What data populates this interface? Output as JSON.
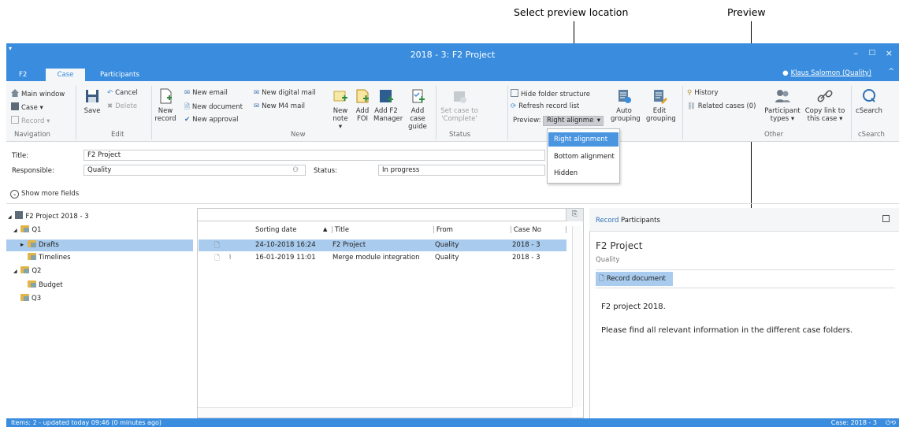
{
  "annotations": {
    "select_preview_location": "Select preview location",
    "preview": "Preview"
  },
  "window": {
    "title": "2018 - 3: F2 Project",
    "qat_icon": "chevron-down-icon",
    "user": "Klaus Salomon (Quality)",
    "controls": {
      "minimize": "–",
      "maximize": "□",
      "close": "×",
      "collapse": "^"
    }
  },
  "tabs": [
    {
      "label": "F2"
    },
    {
      "label": "Case"
    },
    {
      "label": "Participants"
    }
  ],
  "ribbon": {
    "navigation": {
      "label": "Navigation",
      "main_window": "Main window",
      "case": "Case ▾",
      "record": "Record ▾"
    },
    "edit": {
      "label": "Edit",
      "save": "Save",
      "cancel": "Cancel",
      "delete": "Delete"
    },
    "new": {
      "label": "New",
      "new_record": [
        "New",
        "record"
      ],
      "new_email": "New email",
      "new_document": "New document",
      "new_approval": "New approval",
      "new_digital_mail": "New digital mail",
      "new_m4_mail": "New M4 mail",
      "new_note": [
        "New",
        "note ▾"
      ],
      "add_foi": [
        "Add",
        "FOI"
      ],
      "add_f2_manager": [
        "Add F2",
        "Manager"
      ],
      "add_case_guide": [
        "Add case",
        "guide"
      ]
    },
    "status": {
      "label": "Status",
      "set_case": [
        "Set case to",
        "'Complete'"
      ]
    },
    "preview": {
      "hide_folder_structure": "Hide folder structure",
      "refresh_record_list": "Refresh record list",
      "preview_label": "Preview:",
      "selected": "Right alignme",
      "options": [
        "Right alignment",
        "Bottom alignment",
        "Hidden"
      ],
      "auto_grouping": [
        "Auto",
        "grouping"
      ],
      "edit_grouping": [
        "Edit",
        "grouping"
      ]
    },
    "other": {
      "label": "Other",
      "history": "History",
      "related_cases": "Related cases (0)",
      "participant_types": [
        "Participant",
        "types ▾"
      ],
      "copy_link": [
        "Copy link to",
        "this case ▾"
      ]
    },
    "csearch": {
      "label": "cSearch",
      "button": "cSearch"
    }
  },
  "fields": {
    "title_label": "Title:",
    "title_value": "F2 Project",
    "responsible_label": "Responsible:",
    "responsible_value": "Quality",
    "status_label": "Status:",
    "status_value": "In progress",
    "show_more": "Show more fields"
  },
  "tree": [
    {
      "label": "F2 Project 2018 - 3",
      "expander": "◢"
    },
    {
      "label": "Q1",
      "expander": "◢"
    },
    {
      "label": "Drafts",
      "expander": "▸"
    },
    {
      "label": "Timelines",
      "expander": ""
    },
    {
      "label": "Q2",
      "expander": "◢"
    },
    {
      "label": "Budget",
      "expander": ""
    },
    {
      "label": "Q3",
      "expander": ""
    }
  ],
  "list": {
    "columns": [
      "Sorting date",
      "Title",
      "From",
      "Case No"
    ],
    "sort_indicator": "▲",
    "rows": [
      {
        "date": "24-10-2018 16:24",
        "title": "F2 Project",
        "from": "Quality",
        "case_no": "2018 - 3"
      },
      {
        "date": "16-01-2019 11:01",
        "title": "Merge module integration",
        "from": "Quality",
        "case_no": "2018 - 3"
      }
    ]
  },
  "preview_pane": {
    "tabs": [
      "Record",
      "Participants"
    ],
    "title": "F2 Project",
    "subtitle": "Quality",
    "document_button": "Record document",
    "body_line1": "F2 project 2018.",
    "body_line2": "Please find all relevant information in the different case folders."
  },
  "statusbar": {
    "left": "Items: 2 - updated today 09:46 (0 minutes ago)",
    "right": "Case: 2018 - 3"
  },
  "colors": {
    "accent": "#3a8dde",
    "selection": "#a9cbed",
    "ribbon_bg": "#f4f6f8"
  }
}
